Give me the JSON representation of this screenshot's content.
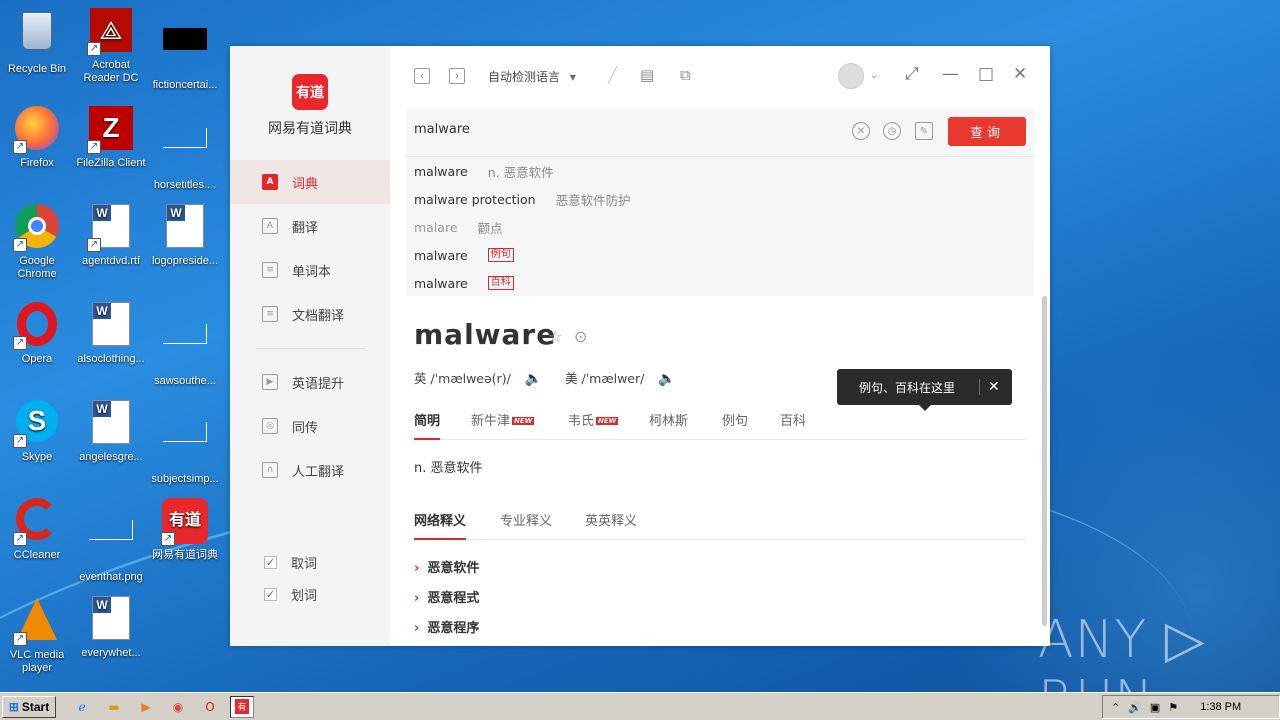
{
  "desktop": {
    "icons": [
      {
        "label": "Recycle Bin"
      },
      {
        "label": "Acrobat Reader DC"
      },
      {
        "label": "fictioncertai..."
      },
      {
        "label": "Firefox"
      },
      {
        "label": "FileZilla Client"
      },
      {
        "label": "horsetitles...."
      },
      {
        "label": "Google Chrome"
      },
      {
        "label": "agentdvd.rtf"
      },
      {
        "label": "logopreside..."
      },
      {
        "label": "Opera"
      },
      {
        "label": "alsoclothing..."
      },
      {
        "label": "sawsouthe..."
      },
      {
        "label": "Skype"
      },
      {
        "label": "angelesgre..."
      },
      {
        "label": "subjectsimp..."
      },
      {
        "label": "CCleaner"
      },
      {
        "label": "eventhat.png"
      },
      {
        "label": "网易有道词典"
      },
      {
        "label": "VLC media player"
      },
      {
        "label": "everywhet..."
      }
    ],
    "watermark": "ANY ▷ RUN"
  },
  "taskbar": {
    "start_label": "Start",
    "clock": "1:38 PM"
  },
  "app": {
    "logo_text": "有道",
    "brand": "网易有道词典",
    "nav": [
      {
        "label": "词典",
        "icon": "A"
      },
      {
        "label": "翻译",
        "icon": "A"
      },
      {
        "label": "单词本",
        "icon": "≡"
      },
      {
        "label": "文档翻译",
        "icon": "≡"
      },
      {
        "label": "英语提升",
        "icon": "▶"
      },
      {
        "label": "同传",
        "icon": "◎"
      },
      {
        "label": "人工翻译",
        "icon": "∩"
      }
    ],
    "checks": [
      {
        "label": "取词",
        "checked": true
      },
      {
        "label": "划词",
        "checked": true
      }
    ],
    "toolbar": {
      "back": "‹",
      "forward": "›",
      "lang_select": "自动检测语言",
      "lang_arrow": "▾"
    },
    "search": {
      "value": "malware",
      "query_button": "查询"
    },
    "suggestions": [
      {
        "word": "malware",
        "def": "n. 恶意软件",
        "tag": ""
      },
      {
        "word": "malware protection",
        "def": "恶意软件防护",
        "tag": ""
      },
      {
        "word": "malare",
        "def": "颧点",
        "tag": ""
      },
      {
        "word": "malware",
        "def": "",
        "tag": "例句"
      },
      {
        "word": "malware",
        "def": "",
        "tag": "百科"
      }
    ],
    "entry": {
      "word": "malware",
      "uk_label": "英",
      "uk_phonetic": "/ˈmælweə(r)/",
      "us_label": "美",
      "us_phonetic": "/ˈmælwer/",
      "tooltip": "例句、百科在这里"
    },
    "tabs": [
      {
        "label": "简明",
        "new": false
      },
      {
        "label": "新牛津",
        "new": true
      },
      {
        "label": "韦氏",
        "new": true
      },
      {
        "label": "柯林斯",
        "new": false
      },
      {
        "label": "例句",
        "new": false
      },
      {
        "label": "百科",
        "new": false
      }
    ],
    "new_badge": "NEW",
    "brief_def": "n. 恶意软件",
    "tabs2": [
      {
        "label": "网络释义"
      },
      {
        "label": "专业释义"
      },
      {
        "label": "英英释义"
      }
    ],
    "web_defs": [
      "恶意软件",
      "恶意程式",
      "恶意程序"
    ],
    "accent": "#e0282a"
  }
}
